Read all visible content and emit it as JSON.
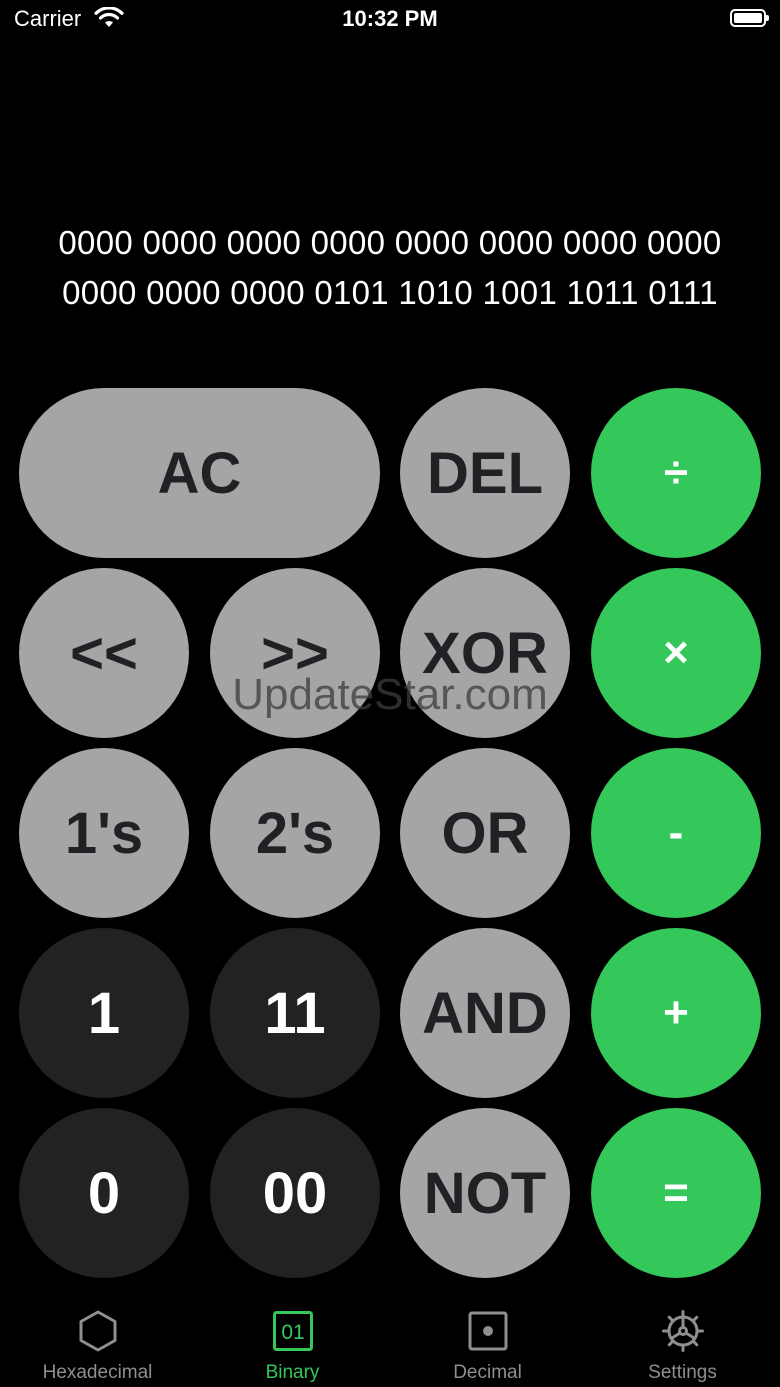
{
  "status_bar": {
    "carrier": "Carrier",
    "time": "10:32 PM"
  },
  "display": {
    "line1": "0000 0000 0000 0000 0000 0000 0000 0000",
    "line2": "0000 0000 0000 0101 1010 1001 1011 0111"
  },
  "keys": {
    "ac": "AC",
    "del": "DEL",
    "divide": "÷",
    "shift_left": "<<",
    "shift_right": ">>",
    "xor": "XOR",
    "multiply": "×",
    "ones_complement": "1's",
    "twos_complement": "2's",
    "or": "OR",
    "minus": "-",
    "one": "1",
    "one_one": "11",
    "and": "AND",
    "plus": "+",
    "zero": "0",
    "zero_zero": "00",
    "not": "NOT",
    "equals": "="
  },
  "watermark": "UpdateStar.com",
  "tabs": [
    {
      "label": "Hexadecimal",
      "icon": "hexagon-icon"
    },
    {
      "label": "Binary",
      "icon": "binary-01-icon",
      "badge": "01",
      "active": true
    },
    {
      "label": "Decimal",
      "icon": "decimal-dot-icon"
    },
    {
      "label": "Settings",
      "icon": "gear-icon"
    }
  ],
  "colors": {
    "accent": "#34c759",
    "light_key": "#a5a5a5",
    "dark_key": "#202224",
    "inactive_tab": "#8e8e93"
  }
}
